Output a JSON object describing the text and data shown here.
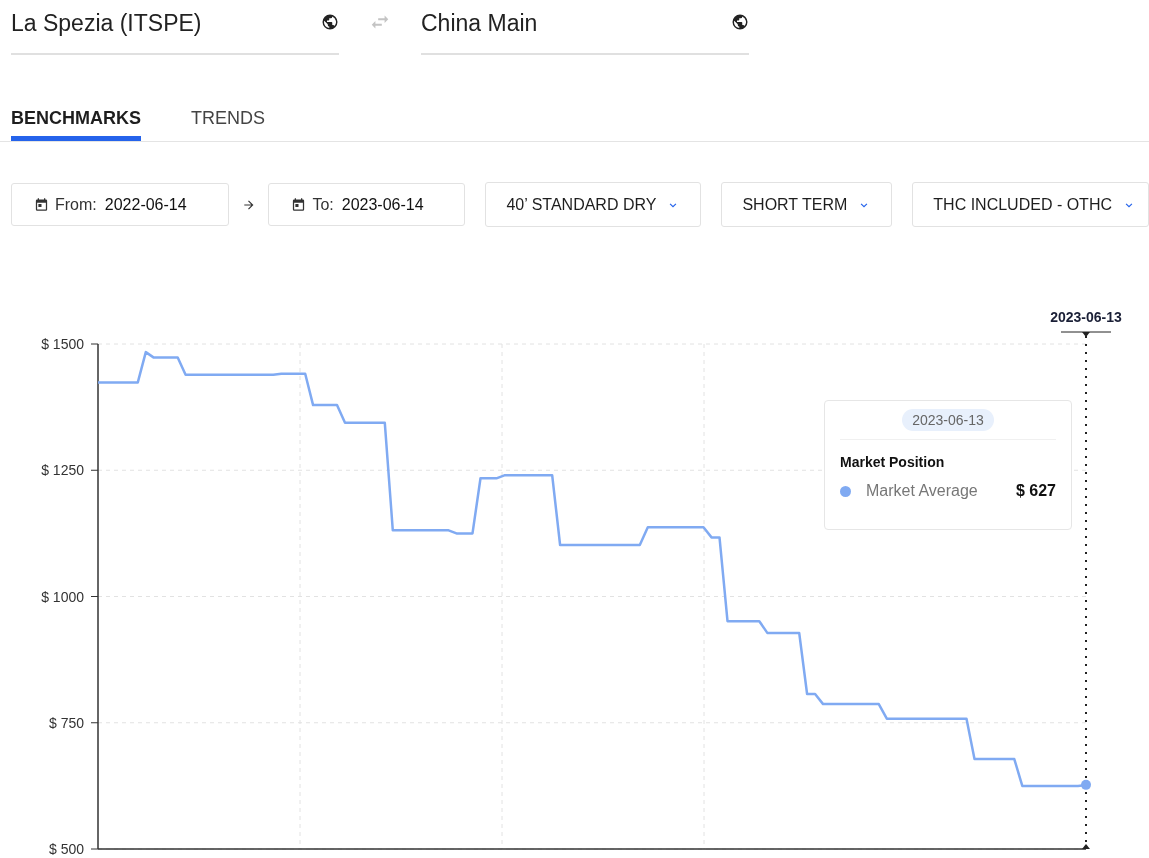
{
  "origin": {
    "value": "La Spezia (ITSPE)"
  },
  "destination": {
    "value": "China Main"
  },
  "tabs": [
    {
      "label": "BENCHMARKS",
      "selected": true
    },
    {
      "label": "TRENDS",
      "selected": false
    }
  ],
  "filters": [
    {
      "kind": "date",
      "label": "From:",
      "value": "2022-06-14"
    },
    {
      "kind": "date",
      "label": "To:",
      "value": "2023-06-14"
    },
    {
      "kind": "dropdown",
      "label": "40’ STANDARD DRY"
    },
    {
      "kind": "dropdown",
      "label": "SHORT TERM"
    },
    {
      "kind": "dropdown",
      "label": "THC INCLUDED - OTHC"
    }
  ],
  "chart": {
    "chart_data": {
      "type": "line",
      "categories": [
        null,
        null,
        null,
        null,
        null,
        null,
        null,
        null,
        null,
        null,
        null,
        null,
        null,
        null,
        null,
        null,
        null,
        null,
        null,
        null,
        null,
        null,
        null,
        null,
        null,
        null,
        null,
        null,
        null,
        null,
        null,
        null,
        null,
        null,
        null,
        null,
        null,
        null,
        null,
        null,
        null,
        null,
        null,
        null,
        null,
        null,
        null,
        null,
        null,
        null,
        null,
        null,
        null,
        null,
        null,
        null,
        null,
        null,
        null,
        null,
        null,
        null,
        null,
        null,
        null,
        null,
        null,
        null,
        null,
        null,
        null,
        null,
        null,
        null,
        null,
        null,
        null,
        null,
        null,
        null,
        null,
        null,
        null,
        null,
        null,
        null,
        null,
        null,
        null,
        null,
        null,
        null,
        null,
        null,
        null,
        null,
        null,
        null,
        null,
        null,
        null,
        null,
        null,
        null,
        null,
        null,
        null,
        null,
        null,
        null,
        null,
        null,
        null,
        null,
        null,
        null,
        null,
        null,
        null,
        null,
        null,
        null,
        null,
        null,
        null
      ],
      "series": [
        {
          "name": "Market Average",
          "color": "#80aaf2",
          "values": [
            1424,
            1424,
            1424,
            1424,
            1424,
            1424,
            1484,
            1473,
            1473,
            1473,
            1473,
            1439,
            1439,
            1439,
            1439,
            1439,
            1439,
            1439,
            1439,
            1439,
            1439,
            1439,
            1439,
            1441,
            1441,
            1441,
            1441,
            1379,
            1379,
            1379,
            1379,
            1344,
            1344,
            1344,
            1344,
            1344,
            1344,
            1131,
            1131,
            1131,
            1131,
            1131,
            1131,
            1131,
            1131,
            1125,
            1125,
            1125,
            1234,
            1234,
            1234,
            1240,
            1240,
            1240,
            1240,
            1240,
            1240,
            1240,
            1102,
            1102,
            1102,
            1102,
            1102,
            1102,
            1102,
            1102,
            1102,
            1102,
            1102,
            1137,
            1137,
            1137,
            1137,
            1137,
            1137,
            1137,
            1137,
            1117,
            1117,
            951,
            951,
            951,
            951,
            951,
            928,
            928,
            928,
            928,
            928,
            807,
            807,
            787,
            787,
            787,
            787,
            787,
            787,
            787,
            787,
            758,
            758,
            758,
            758,
            758,
            758,
            758,
            758,
            758,
            758,
            758,
            678,
            678,
            678,
            678,
            678,
            678,
            625,
            625,
            625,
            625,
            625,
            625,
            625,
            625,
            627
          ]
        }
      ],
      "ylim": [
        500,
        1500
      ],
      "grid": true,
      "yticks": [
        {
          "value": 500,
          "label": "$ 500"
        },
        {
          "value": 750,
          "label": "$ 750"
        },
        {
          "value": 1000,
          "label": "$ 1000"
        },
        {
          "value": 1250,
          "label": "$ 1250"
        },
        {
          "value": 1500,
          "label": "$ 1500"
        }
      ]
    },
    "cursor_date": "2023-06-13",
    "tooltip": {
      "date": "2023-06-13",
      "heading": "Market Position",
      "value": "$ 627"
    }
  }
}
